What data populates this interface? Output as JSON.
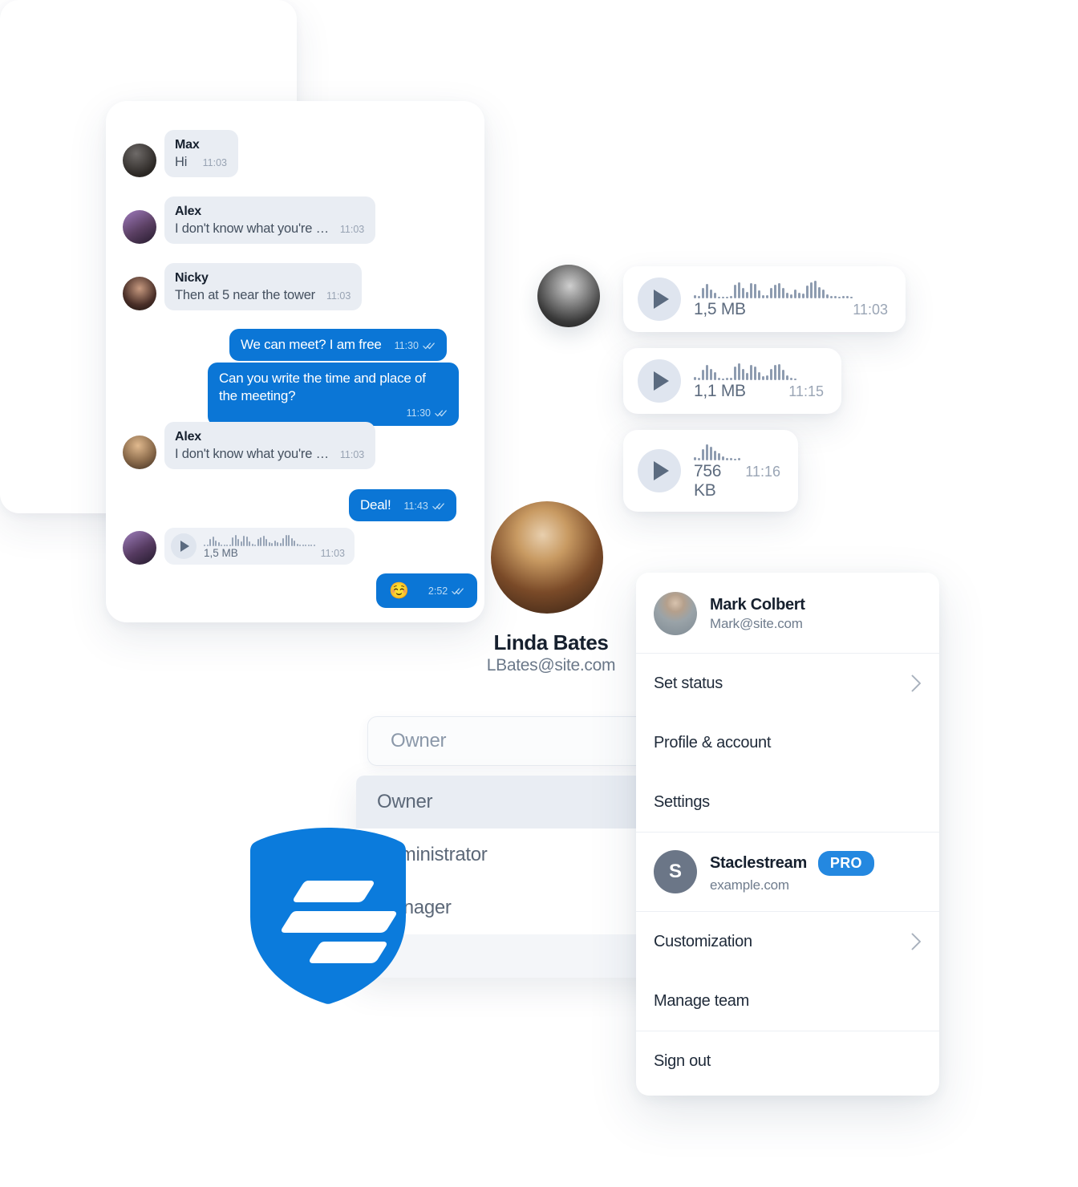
{
  "colors": {
    "brand_blue": "#0b76d6",
    "shield_blue": "#0b7bdc",
    "pro_badge_blue": "#2488e0",
    "incoming_bubble": "#e9edf3",
    "text_dark": "#16202e",
    "text_muted": "#6f7c8d"
  },
  "chat": {
    "messages": [
      {
        "kind": "incoming",
        "name": "Max",
        "text": "Hi",
        "time": "11:03"
      },
      {
        "kind": "incoming",
        "name": "Alex",
        "text": "I don't know what you're …",
        "time": "11:03"
      },
      {
        "kind": "incoming",
        "name": "Nicky",
        "text": "Then at 5 near the tower",
        "time": "11:03"
      },
      {
        "kind": "outgoing",
        "text": "We can meet? I am free",
        "time": "11:30",
        "status": "read"
      },
      {
        "kind": "outgoing",
        "text": "Can you write the time and place of the meeting?",
        "time": "11:30",
        "status": "read"
      },
      {
        "kind": "incoming",
        "name": "Alex",
        "text": "I don't know what you're …",
        "time": "11:03"
      },
      {
        "kind": "outgoing",
        "text": "Deal!",
        "time": "11:43",
        "status": "read"
      },
      {
        "kind": "voice-in",
        "size": "1,5 MB",
        "time": "11:03"
      },
      {
        "kind": "outgoing-emoji",
        "emoji": "☺️",
        "time": "2:52",
        "status": "read"
      }
    ]
  },
  "voice_cards": [
    {
      "size": "1,5 MB",
      "time": "11:03"
    },
    {
      "size": "1,1 MB",
      "time": "11:15"
    },
    {
      "size": "756 KB",
      "time": "11:16"
    }
  ],
  "profile": {
    "name": "Linda Bates",
    "email": "LBates@site.com",
    "role_field_placeholder": "Owner",
    "role_options": [
      "Owner",
      "Administrator",
      "Manager"
    ],
    "role_selected": "Owner"
  },
  "account_menu": {
    "user": {
      "name": "Mark Colbert",
      "email": "Mark@site.com"
    },
    "items_top": [
      {
        "label": "Set status",
        "chevron": true
      },
      {
        "label": "Profile & account",
        "chevron": false
      },
      {
        "label": "Settings",
        "chevron": false
      }
    ],
    "workspace": {
      "initial": "S",
      "name": "Staclestream",
      "domain": "example.com",
      "badge": "PRO"
    },
    "items_bottom": [
      {
        "label": "Customization",
        "chevron": true
      },
      {
        "label": "Manage team",
        "chevron": false
      }
    ],
    "sign_out": "Sign out"
  }
}
